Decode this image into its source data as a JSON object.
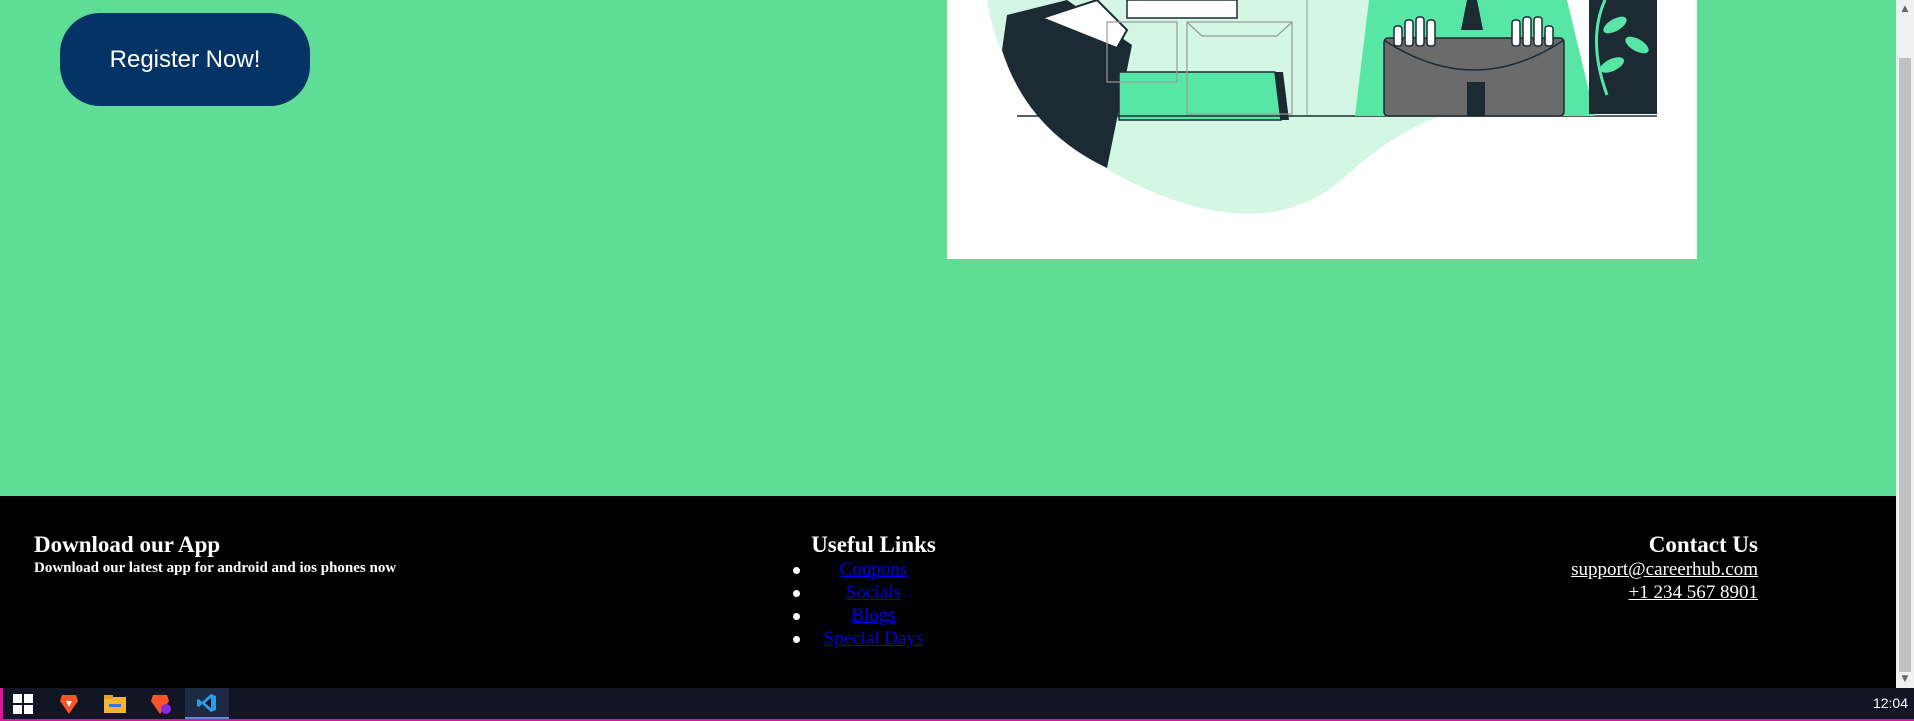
{
  "hero": {
    "register_label": "Register Now!",
    "background": "#5ddd96",
    "button_color": "#063366"
  },
  "footer": {
    "app": {
      "title": "Download our App",
      "subtitle": "Download our latest app for android and ios phones now"
    },
    "links": {
      "title": "Useful Links",
      "items": [
        "Coupons",
        "Socials",
        "Blogs",
        "Special Days"
      ]
    },
    "contact": {
      "title": "Contact Us",
      "email": "support@careerhub.com",
      "phone": "+1 234 567 8901"
    }
  },
  "scrollbar": {
    "up_arrow": "▲",
    "down_arrow": "▼"
  },
  "taskbar": {
    "icons": [
      "windows-start-icon",
      "brave-browser-icon",
      "file-explorer-icon",
      "brave-browser-alt-icon",
      "vscode-icon"
    ],
    "clock": "12:04",
    "accent": "#e0149b"
  }
}
